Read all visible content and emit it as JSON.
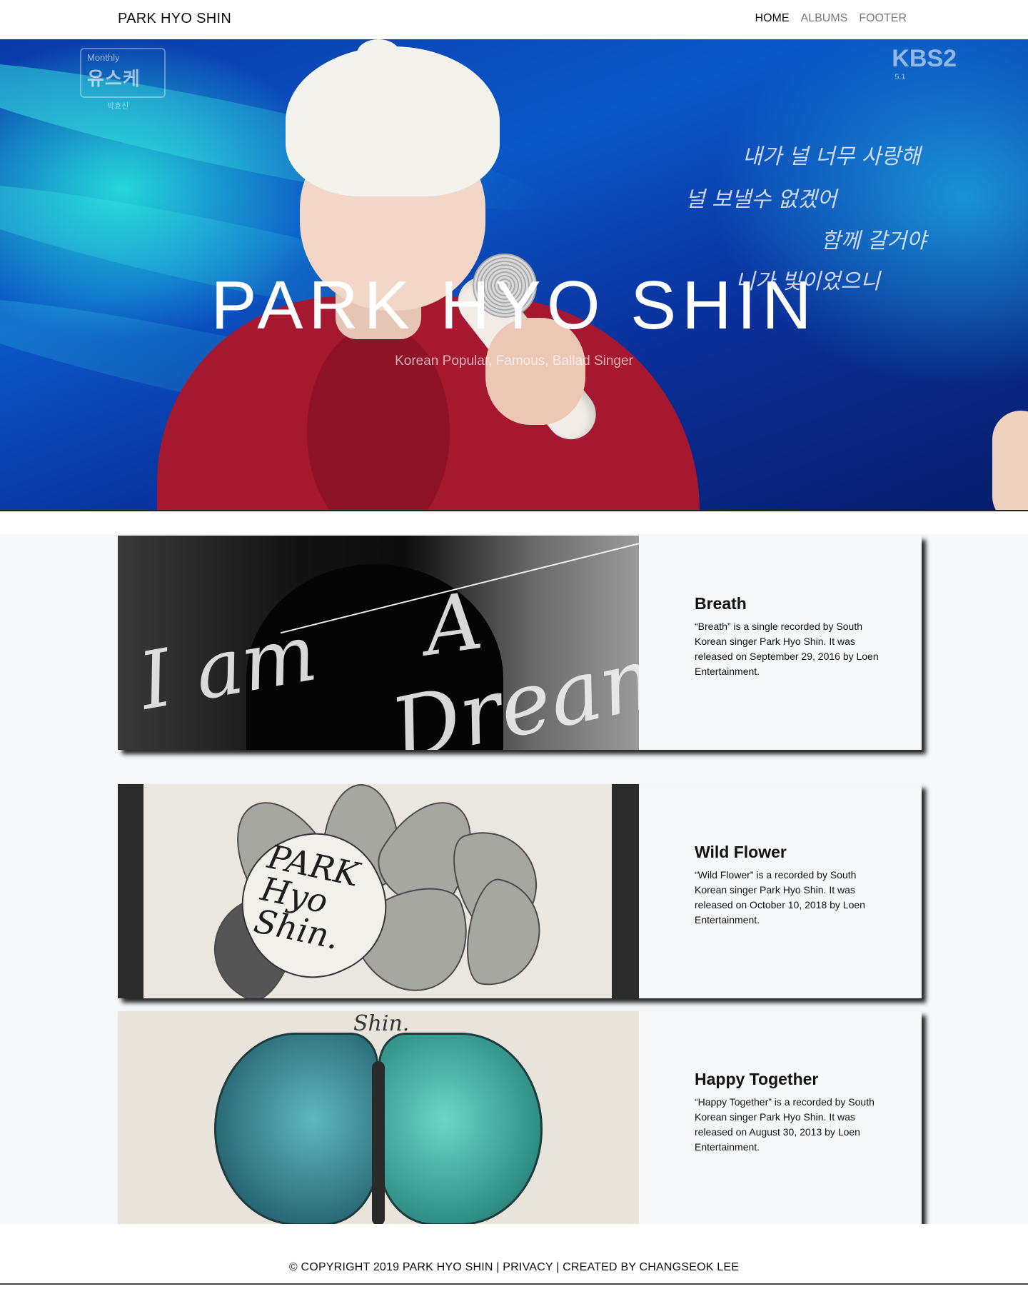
{
  "navbar": {
    "brand": "PARK HYO SHIN",
    "links": [
      {
        "label": "HOME",
        "active": true
      },
      {
        "label": "ALBUMS",
        "active": false
      },
      {
        "label": "FOOTER",
        "active": false
      }
    ]
  },
  "hero": {
    "title": "PARK HYO SHIN",
    "subtitle": "Korean Popular, Famous, Ballad Singer",
    "broadcast_logo": {
      "top": "Monthly",
      "main": "유스케",
      "sub": "박효신"
    },
    "channel_logo": {
      "name": "KBS2",
      "sub": "5.1"
    },
    "lyrics": [
      "내가 널 너무 사랑해",
      "널 보낼수 없겠어",
      "함께 갈거야",
      "니가 빛이었으니"
    ]
  },
  "albums": [
    {
      "title": "Breath",
      "description": "“Breath” is a single recorded by South Korean singer Park Hyo Shin. It was released on September 29, 2016 by Loen Entertainment.",
      "cover_text": [
        "I am",
        "A",
        "Dreamer"
      ]
    },
    {
      "title": "Wild Flower",
      "description": "“Wild Flower” is a recorded by South Korean singer Park Hyo Shin. It was released on October 10, 2018 by Loen Entertainment.",
      "cover_text": [
        "PARK",
        "Hyo",
        "Shin."
      ]
    },
    {
      "title": "Happy Together",
      "description": "“Happy Together” is a recorded by South Korean singer Park Hyo Shin. It was released on August 30, 2013 by Loen Entertainment.",
      "cover_text": [
        "Shin."
      ]
    }
  ],
  "footer": {
    "copyright": "© COPYRIGHT 2019 PARK HYO SHIN",
    "privacy": "PRIVACY",
    "credit": "CREATED BY CHANGSEOK LEE"
  }
}
